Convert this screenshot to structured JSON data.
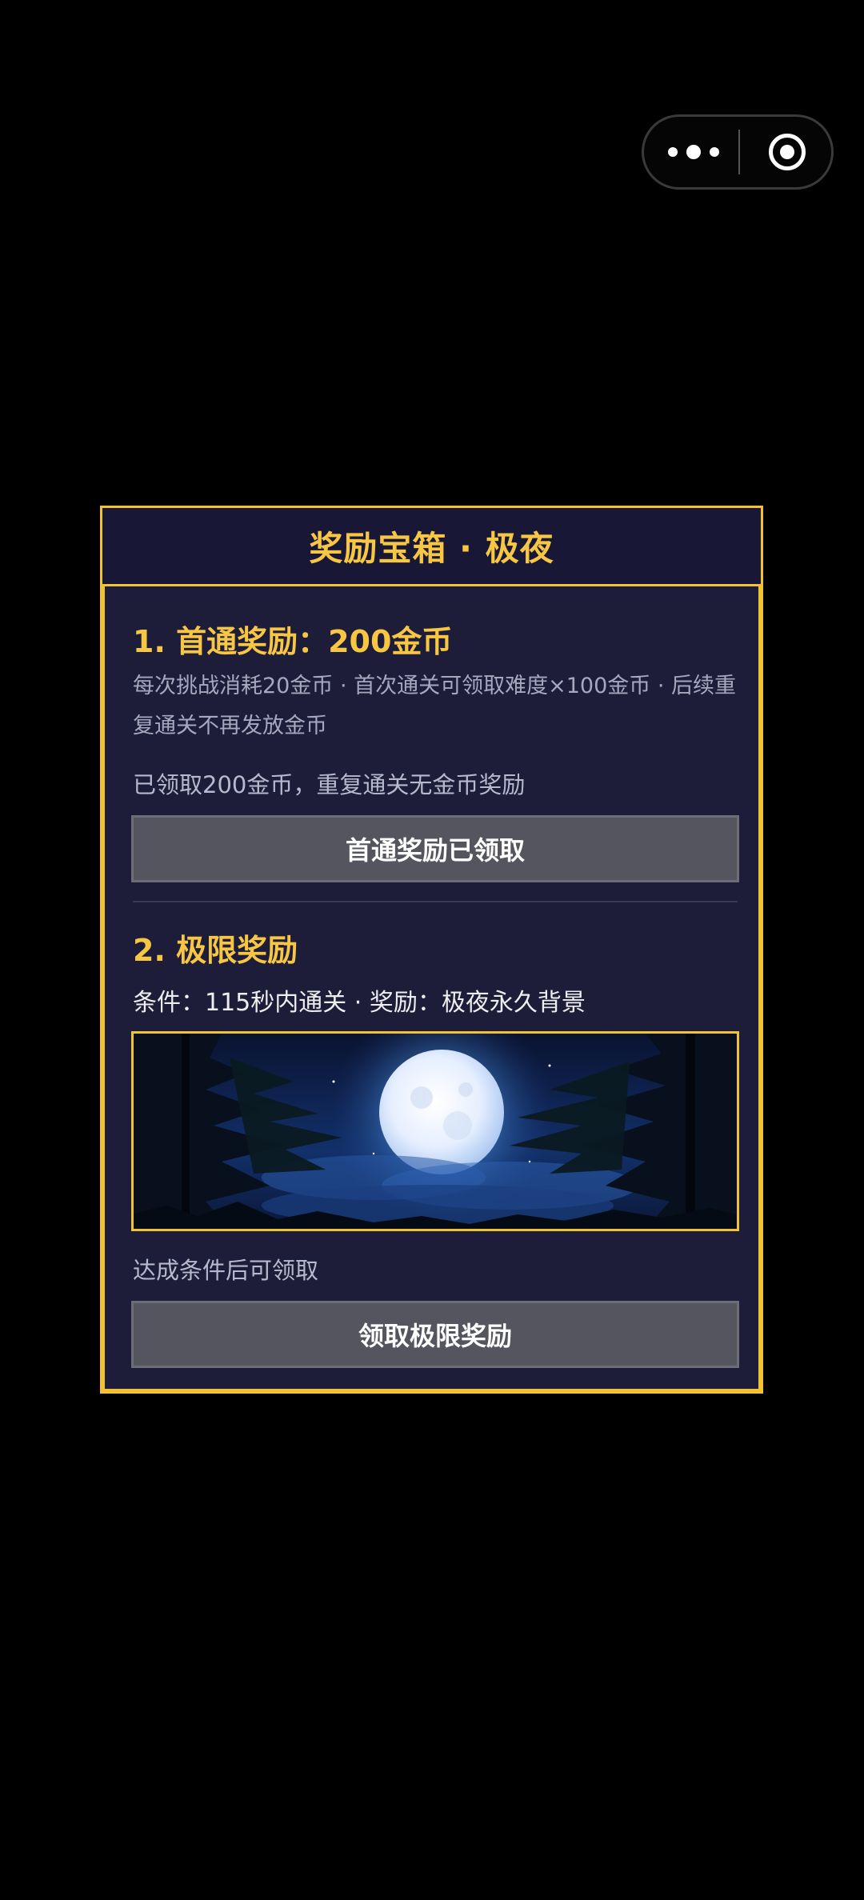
{
  "modal": {
    "title": "奖励宝箱 · 极夜"
  },
  "first_clear": {
    "title": "1. 首通奖励：200金币",
    "description": "每次挑战消耗20金币 · 首次通关可领取难度×100金币 · 后续重复通关不再发放金币",
    "status": "已领取200金币，重复通关无金币奖励",
    "button_label": "首通奖励已领取"
  },
  "limit_reward": {
    "title": "2. 极限奖励",
    "condition": "条件：115秒内通关 · 奖励：极夜永久背景",
    "preview_image": "full-moon-night-forest",
    "status": "达成条件后可领取",
    "button_label": "领取极限奖励"
  },
  "colors": {
    "accent": "#f1c232",
    "panel": "#1d1d3a",
    "button": "#55555f"
  }
}
